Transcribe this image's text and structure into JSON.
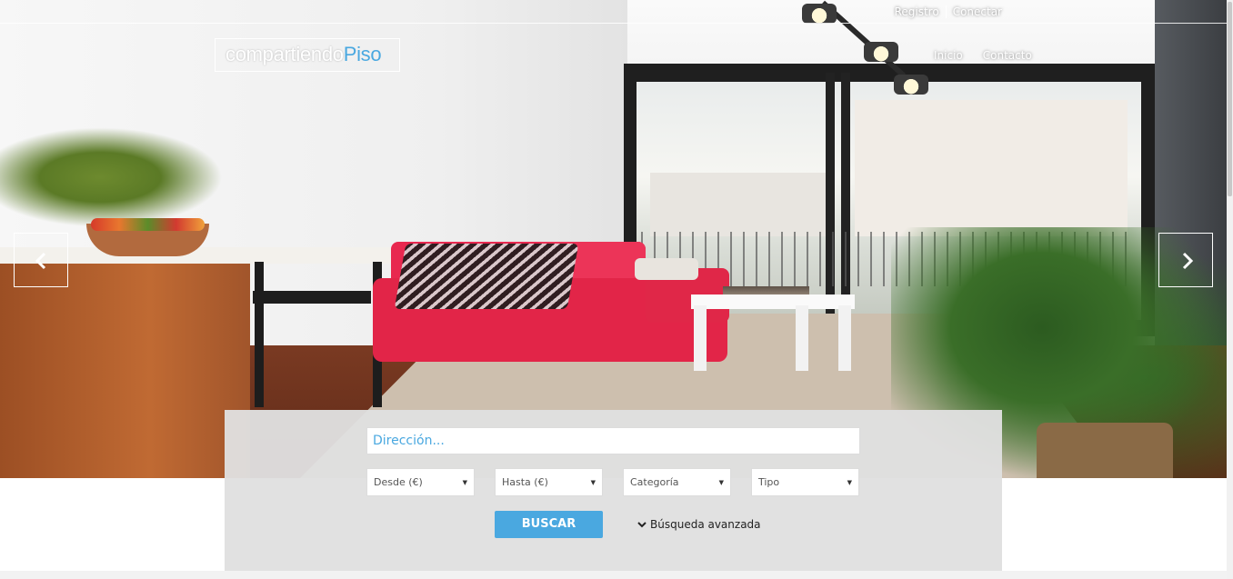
{
  "toplinks": {
    "registro": "Registro",
    "conectar": "Conectar"
  },
  "logo": {
    "part1": "compartiendo",
    "part2": "Piso"
  },
  "nav": {
    "inicio": "Inicio",
    "contacto": "Contacto"
  },
  "carousel": {
    "prev_icon": "chevron-left-icon",
    "next_icon": "chevron-right-icon"
  },
  "search": {
    "address_placeholder": "Dirección...",
    "desde": "Desde (€)",
    "hasta": "Hasta (€)",
    "categoria": "Categoría",
    "tipo": "Tipo",
    "button": "BUSCAR",
    "advanced": "Búsqueda avanzada"
  },
  "colors": {
    "accent": "#4aa8e0",
    "panel": "#e0e0e0",
    "border": "#ffffff"
  }
}
